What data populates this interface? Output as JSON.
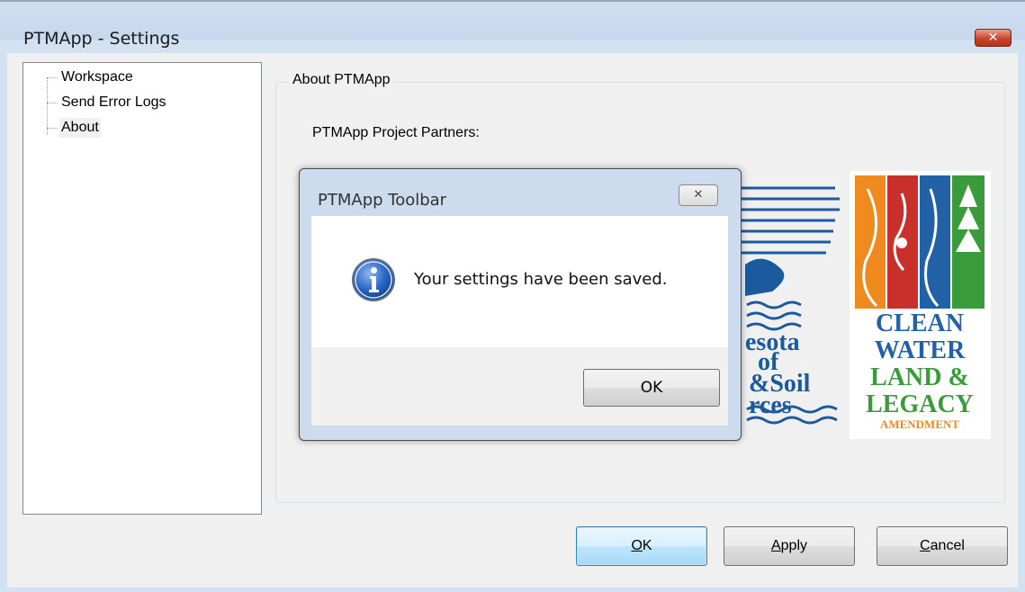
{
  "window": {
    "title": "PTMApp - Settings",
    "close_glyph": "✕"
  },
  "tree": {
    "items": [
      {
        "label": "Workspace"
      },
      {
        "label": "Send Error Logs"
      },
      {
        "label": "About",
        "selected": true
      }
    ]
  },
  "about": {
    "group_label": "About PTMApp",
    "partners_label": "PTMApp Project Partners:",
    "logo_bwsr": {
      "lines": [
        "esota",
        "of",
        "&Soil",
        "rces"
      ]
    },
    "logo_clean_water": {
      "lines": [
        "CLEAN",
        "WATER",
        "LAND &",
        "LEGACY",
        "AMENDMENT"
      ]
    }
  },
  "buttons": {
    "ok": {
      "accel": "O",
      "rest": "K"
    },
    "apply": {
      "accel": "A",
      "rest": "pply"
    },
    "cancel": {
      "accel": "C",
      "rest": "ancel"
    }
  },
  "modal": {
    "title": "PTMApp Toolbar",
    "close_glyph": "✕",
    "icon": "info-icon",
    "message": "Your settings have been saved.",
    "ok_label": "OK"
  },
  "colors": {
    "window_frame": "#d3e2f3",
    "close_red": "#c8442a",
    "default_button_border": "#3c7fb1",
    "info_blue": "#2a66c7"
  }
}
